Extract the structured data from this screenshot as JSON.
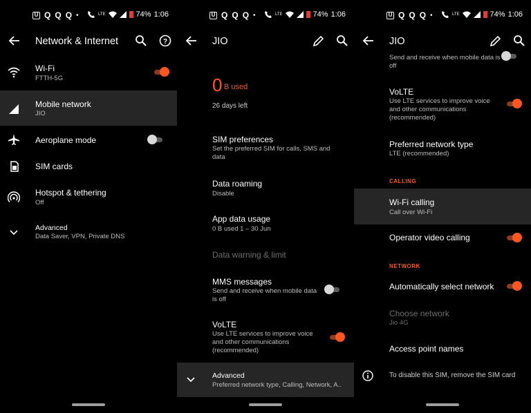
{
  "status": {
    "left_icons": [
      "U",
      "Q",
      "Q",
      "Q",
      "•"
    ],
    "battery": "74%",
    "time": "1:06",
    "lte": "LTE"
  },
  "panel1": {
    "title": "Network & Internet",
    "items": [
      {
        "title": "Wi-Fi",
        "sub": "FTTH-5G",
        "icon": "wifi-icon",
        "toggle": "on"
      },
      {
        "title": "Mobile network",
        "sub": "JIO",
        "icon": "signal-icon"
      },
      {
        "title": "Aeroplane mode",
        "icon": "airplane-icon",
        "toggle": "off"
      },
      {
        "title": "SIM cards",
        "icon": "sim-card-icon"
      },
      {
        "title": "Hotspot & tethering",
        "sub": "Off",
        "icon": "hotspot-icon"
      },
      {
        "title": "Advanced",
        "sub": "Data Saver, VPN, Private DNS",
        "icon": "chevron-down-icon"
      }
    ]
  },
  "panel2": {
    "title": "JIO",
    "usage_value": "0",
    "usage_unit": "B used",
    "days_left": "26 days left",
    "items": [
      {
        "title": "SIM preferences",
        "sub": "Set the preferred SIM for calls, SMS and data"
      },
      {
        "title": "Data roaming",
        "sub": "Disable"
      },
      {
        "title": "App data usage",
        "sub": "0 B used 1 – 30 Jun"
      },
      {
        "title": "Data warning & limit"
      },
      {
        "title": "MMS messages",
        "sub": "Send and receive when mobile data is off",
        "toggle": "off"
      },
      {
        "title": "VoLTE",
        "sub": "Use LTE services to improve voice and other communications (recommended)",
        "toggle": "on"
      },
      {
        "title": "Advanced",
        "sub": "Preferred network type, Calling, Network, A.."
      }
    ]
  },
  "panel3": {
    "title": "JIO",
    "top_sub": "Send and receive when mobile data is off",
    "volte": {
      "title": "VoLTE",
      "sub": "Use LTE services to improve voice and other communications (recommended)"
    },
    "pref_network": {
      "title": "Preferred network type",
      "sub": "LTE (recommended)"
    },
    "cat_calling": "CALLING",
    "wifi_calling": {
      "title": "Wi-Fi calling",
      "sub": "Call over Wi-Fi"
    },
    "video_calling": {
      "title": "Operator video calling"
    },
    "cat_network": "NETWORK",
    "auto_select": {
      "title": "Automatically select network"
    },
    "choose_network": {
      "title": "Choose network",
      "sub": "Jio 4G"
    },
    "apn": {
      "title": "Access point names"
    },
    "disable_note": "To disable this SIM, remove the SIM card"
  },
  "colors": {
    "accent": "#ff5722",
    "background": "#000000",
    "selected_row": "#262626"
  }
}
